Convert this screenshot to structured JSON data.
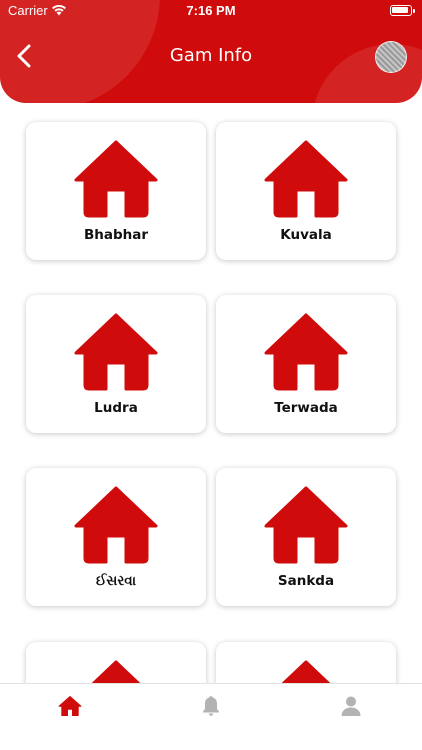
{
  "status_bar": {
    "carrier": "Carrier",
    "time": "7:16 PM"
  },
  "header": {
    "title": "Gam Info",
    "back_icon": "chevron-left-icon",
    "avatar": "profile-photo"
  },
  "villages": [
    {
      "name": "Bhabhar"
    },
    {
      "name": "Kuvala"
    },
    {
      "name": "Ludra"
    },
    {
      "name": "Terwada"
    },
    {
      "name": "ઈસરવા"
    },
    {
      "name": "Sankda"
    },
    {
      "name": ""
    },
    {
      "name": ""
    }
  ],
  "tabbar": {
    "items": [
      {
        "icon": "home-icon",
        "active": true
      },
      {
        "icon": "bell-icon",
        "active": false
      },
      {
        "icon": "user-icon",
        "active": false
      }
    ]
  },
  "colors": {
    "accent": "#cf0b0b",
    "inactive_icon": "#b3b3b3",
    "card_bg": "#ffffff"
  }
}
